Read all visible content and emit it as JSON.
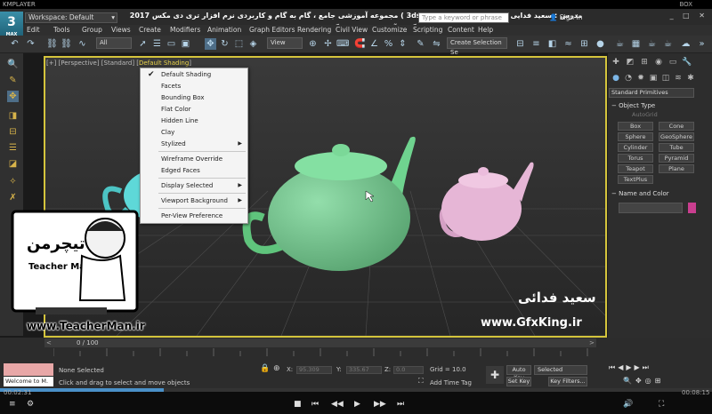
{
  "player": {
    "brand": "KMPLAYER",
    "box": "BOX",
    "elapsed": "00:02:31",
    "remaining": "00:08:15",
    "progress": 0.23
  },
  "app": {
    "logo_text": "3",
    "logo_sub": "MAX",
    "workspace": "Workspace: Default",
    "title_farsi": "مجموعه آموزشی جامع ، گام به گام و کاربردی نرم افزار تری دی مکس 2017 ( 3ds max 2017 )  مدرس : سعید فدایی ( تیچرمن ) گروه آموزشی پادشاه گرافیست ها",
    "search_placeholder": "Type a keyword or phrase",
    "sign_in": "Sign In",
    "window_controls": "_ □ ✕"
  },
  "menubar": [
    "Edit",
    "Tools",
    "Group",
    "Views",
    "Create",
    "Modifiers",
    "Animation",
    "Graph Editors",
    "Rendering",
    "Civil View",
    "Customize",
    "Scripting",
    "Content",
    "Help"
  ],
  "toolbar": {
    "filter": "All",
    "coord": "View",
    "selection_set": "Create Selection Se"
  },
  "viewport": {
    "label_prefix": "[+] [Perspective] [Standard] [",
    "label_active": "Default Shading",
    "label_suffix": "]"
  },
  "context_menu": {
    "items": [
      {
        "label": "Default Shading",
        "checked": true
      },
      {
        "label": "Facets"
      },
      {
        "label": "Bounding Box"
      },
      {
        "label": "Flat Color"
      },
      {
        "label": "Hidden Line"
      },
      {
        "label": "Clay"
      },
      {
        "label": "Stylized",
        "submenu": true
      },
      {
        "label": "Wireframe Override"
      },
      {
        "label": "Edged Faces"
      },
      {
        "label": "Display Selected",
        "submenu": true
      },
      {
        "label": "Viewport Background",
        "submenu": true
      },
      {
        "label": "Per-View Preference"
      }
    ]
  },
  "command_panel": {
    "dropdown": "Standard Primitives",
    "object_type_header": "Object Type",
    "autogrid": "AutoGrid",
    "buttons": [
      "Box",
      "Cone",
      "Sphere",
      "GeoSphere",
      "Cylinder",
      "Tube",
      "Torus",
      "Pyramid",
      "Teapot",
      "Plane",
      "TextPlus"
    ],
    "name_color_header": "Name and Color",
    "swatch_color": "#c93e8f"
  },
  "timeline": {
    "frame": "0 / 100"
  },
  "status": {
    "selection": "None Selected",
    "prompt": "Click and drag to select and move objects",
    "x_label": "X:",
    "x_value": "95.309",
    "y_label": "Y:",
    "y_value": "335.67",
    "z_label": "Z:",
    "z_value": "0.0",
    "grid": "Grid = 10.0",
    "add_time_tag": "Add Time Tag",
    "auto_key": "Auto Key",
    "selected": "Selected",
    "set_key": "Set Key",
    "key_filters": "Key Filters...",
    "welcome": "Welcome to M."
  },
  "watermarks": {
    "teacherman_url": "www.TeacherMan.ir",
    "gfxking_url": "www.GfxKing.ir",
    "gfxking_name": "سعید فدائی",
    "logo_title": "تیچرمن",
    "logo_name": "Teacher Man"
  },
  "colors": {
    "teapot_green": "#6fd38f",
    "teapot_pink": "#e6b6d6",
    "teapot_cyan": "#5ed8d8",
    "viewport_border": "#d4c43c"
  }
}
